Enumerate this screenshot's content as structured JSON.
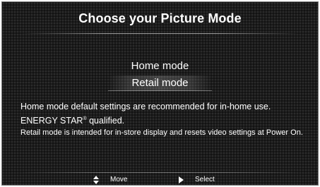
{
  "header": {
    "title": "Choose your Picture Mode"
  },
  "menu": {
    "items": [
      {
        "label": "Home mode",
        "selected": false
      },
      {
        "label": "Retail mode",
        "selected": true
      }
    ]
  },
  "description": {
    "home_text": "Home mode default settings are recommended for in-home use.",
    "energy_star_prefix": "ENERGY STAR",
    "energy_star_mark": "®",
    "energy_star_suffix": " qualified.",
    "retail_text": "Retail mode is intended for in-store display and resets video settings at Power On."
  },
  "footer": {
    "move_icon": "up-down-arrows-icon",
    "move_label": "Move",
    "select_icon": "right-triangle-icon",
    "select_label": "Select"
  },
  "colors": {
    "background": "#1c1c1c",
    "text": "#ffffff"
  }
}
